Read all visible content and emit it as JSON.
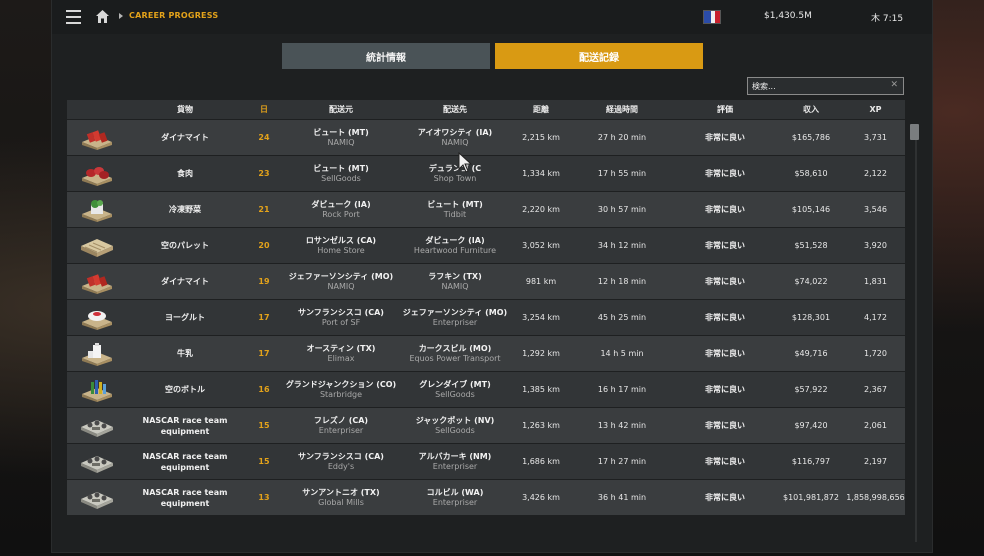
{
  "topbar": {
    "breadcrumb": "CAREER PROGRESS",
    "money": "$1,430.5M",
    "clock": "木 7:15"
  },
  "tabs": {
    "stats": "統計情報",
    "log": "配送記録"
  },
  "search": {
    "placeholder": "検索..."
  },
  "columns": {
    "cargo": "貨物",
    "day": "日",
    "source": "配送元",
    "destination": "配送先",
    "distance": "距離",
    "time": "経過時間",
    "rating": "評価",
    "revenue": "収入",
    "xp": "XP"
  },
  "rows": [
    {
      "cargo": "ダイナマイト",
      "day": "24",
      "src_city": "ビュート (MT)",
      "src_company": "NAMIQ",
      "dst_city": "アイオワシティ (IA)",
      "dst_company": "NAMIQ",
      "distance": "2,215 km",
      "time": "27 h 20 min",
      "rating": "非常に良い",
      "revenue": "$165,786",
      "xp": "3,731",
      "icon": "dynamite-crate-icon"
    },
    {
      "cargo": "食肉",
      "day": "23",
      "src_city": "ビュート (MT)",
      "src_company": "SellGoods",
      "dst_city": "デュランゴ (C",
      "dst_company": "Shop Town",
      "distance": "1,334 km",
      "time": "17 h 55 min",
      "rating": "非常に良い",
      "revenue": "$58,610",
      "xp": "2,122",
      "icon": "meat-crate-icon"
    },
    {
      "cargo": "冷凍野菜",
      "day": "21",
      "src_city": "ダビューク (IA)",
      "src_company": "Rock Port",
      "dst_city": "ビュート (MT)",
      "dst_company": "Tidbit",
      "distance": "2,220 km",
      "time": "30 h 57 min",
      "rating": "非常に良い",
      "revenue": "$105,146",
      "xp": "3,546",
      "icon": "vegetables-crate-icon"
    },
    {
      "cargo": "空のパレット",
      "day": "20",
      "src_city": "ロサンゼルス (CA)",
      "src_company": "Home Store",
      "dst_city": "ダビューク (IA)",
      "dst_company": "Heartwood Furniture",
      "distance": "3,052 km",
      "time": "34 h 12 min",
      "rating": "非常に良い",
      "revenue": "$51,528",
      "xp": "3,920",
      "icon": "pallet-icon"
    },
    {
      "cargo": "ダイナマイト",
      "day": "19",
      "src_city": "ジェファーソンシティ (MO)",
      "src_company": "NAMIQ",
      "dst_city": "ラフキン (TX)",
      "dst_company": "NAMIQ",
      "distance": "981 km",
      "time": "12 h 18 min",
      "rating": "非常に良い",
      "revenue": "$74,022",
      "xp": "1,831",
      "icon": "dynamite-crate-icon"
    },
    {
      "cargo": "ヨーグルト",
      "day": "17",
      "src_city": "サンフランシスコ (CA)",
      "src_company": "Port of SF",
      "dst_city": "ジェファーソンシティ (MO)",
      "dst_company": "Enterpriser",
      "distance": "3,254 km",
      "time": "45 h 25 min",
      "rating": "非常に良い",
      "revenue": "$128,301",
      "xp": "4,172",
      "icon": "yogurt-crate-icon"
    },
    {
      "cargo": "牛乳",
      "day": "17",
      "src_city": "オースティン (TX)",
      "src_company": "Elimax",
      "dst_city": "カークスビル (MO)",
      "dst_company": "Equos Power Transport",
      "distance": "1,292 km",
      "time": "14 h 5 min",
      "rating": "非常に良い",
      "revenue": "$49,716",
      "xp": "1,720",
      "icon": "milk-crate-icon"
    },
    {
      "cargo": "空のボトル",
      "day": "16",
      "src_city": "グランドジャンクション (CO)",
      "src_company": "Starbridge",
      "dst_city": "グレンダイブ (MT)",
      "dst_company": "SellGoods",
      "distance": "1,385 km",
      "time": "16 h 17 min",
      "rating": "非常に良い",
      "revenue": "$57,922",
      "xp": "2,367",
      "icon": "bottles-crate-icon"
    },
    {
      "cargo": "NASCAR race team equipment",
      "day": "15",
      "src_city": "フレズノ (CA)",
      "src_company": "Enterpriser",
      "dst_city": "ジャックポット (NV)",
      "dst_company": "SellGoods",
      "distance": "1,263 km",
      "time": "13 h 42 min",
      "rating": "非常に良い",
      "revenue": "$97,420",
      "xp": "2,061",
      "icon": "race-equipment-icon"
    },
    {
      "cargo": "NASCAR race team equipment",
      "day": "15",
      "src_city": "サンフランシスコ (CA)",
      "src_company": "Eddy's",
      "dst_city": "アルバカーキ (NM)",
      "dst_company": "Enterpriser",
      "distance": "1,686 km",
      "time": "17 h 27 min",
      "rating": "非常に良い",
      "revenue": "$116,797",
      "xp": "2,197",
      "icon": "race-equipment-icon"
    },
    {
      "cargo": "NASCAR race team equipment",
      "day": "13",
      "src_city": "サンアントニオ (TX)",
      "src_company": "Global Mills",
      "dst_city": "コルビル (WA)",
      "dst_company": "Enterpriser",
      "distance": "3,426 km",
      "time": "36 h 41 min",
      "rating": "非常に良い",
      "revenue": "$101,981,872",
      "xp": "1,858,998,656",
      "icon": "race-equipment-icon"
    }
  ]
}
